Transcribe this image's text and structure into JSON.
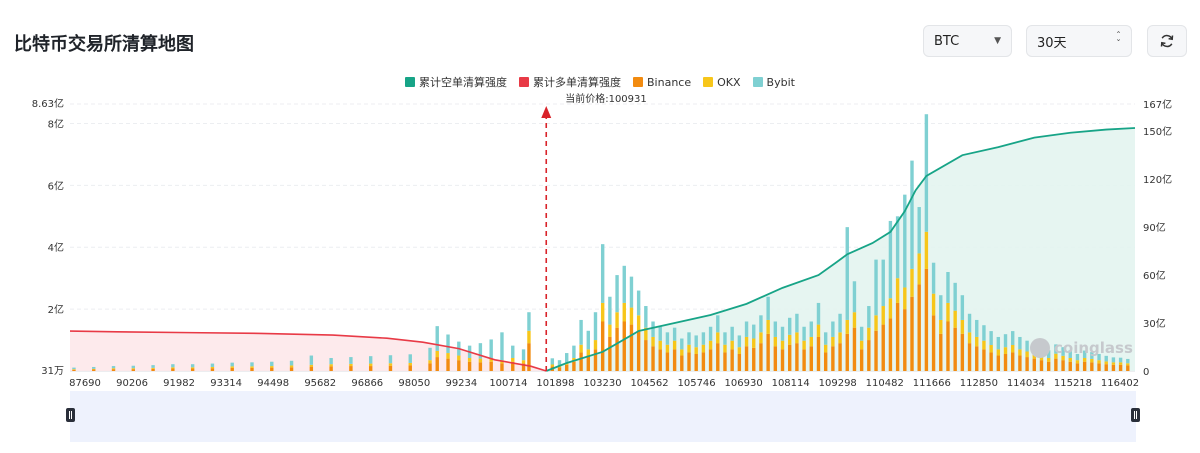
{
  "header": {
    "title": "比特币交易所清算地图"
  },
  "controls": {
    "coin_select": "BTC",
    "range_select": "30天"
  },
  "colors": {
    "short_cum": "#17a487",
    "long_cum": "#e83a46",
    "binance": "#f28b10",
    "okx": "#f7c61a",
    "bybit": "#7fd0d2",
    "price_line": "#d9232a"
  },
  "chart_data": {
    "type": "bar",
    "legend": [
      {
        "name": "累计空单清算强度",
        "color": "#17a487"
      },
      {
        "name": "累计多单清算强度",
        "color": "#e83a46"
      },
      {
        "name": "Binance",
        "color": "#f28b10"
      },
      {
        "name": "OKX",
        "color": "#f7c61a"
      },
      {
        "name": "Bybit",
        "color": "#7fd0d2"
      }
    ],
    "current_price_label": "当前价格:100931",
    "current_price": 100931,
    "x_range": [
      87690,
      117300
    ],
    "x_ticks": [
      "87690",
      "90206",
      "91982",
      "93314",
      "94498",
      "95682",
      "96866",
      "98050",
      "99234",
      "100714",
      "101898",
      "103230",
      "104562",
      "105746",
      "106930",
      "108114",
      "109298",
      "110482",
      "111666",
      "112850",
      "114034",
      "115218",
      "116402"
    ],
    "y_left": {
      "min_label": "31万",
      "max_label": "8.63亿",
      "ticks": [
        {
          "value": 2,
          "label": "2亿"
        },
        {
          "value": 4,
          "label": "4亿"
        },
        {
          "value": 6,
          "label": "6亿"
        },
        {
          "value": 8,
          "label": "8亿"
        }
      ],
      "range": [
        0.0031,
        8.63
      ],
      "unit": "亿"
    },
    "y_right": {
      "ticks": [
        {
          "value": 0,
          "label": "0"
        },
        {
          "value": 30,
          "label": "30亿"
        },
        {
          "value": 60,
          "label": "60亿"
        },
        {
          "value": 90,
          "label": "90亿"
        },
        {
          "value": 120,
          "label": "120亿"
        },
        {
          "value": 150,
          "label": "150亿"
        },
        {
          "value": 167,
          "label": "167亿"
        }
      ],
      "range": [
        0,
        167
      ],
      "unit": "亿"
    },
    "bars": {
      "x": [
        87800,
        88350,
        88900,
        89450,
        90000,
        90550,
        91100,
        91650,
        92200,
        92750,
        93300,
        93850,
        94400,
        94950,
        95500,
        96050,
        96600,
        97150,
        97700,
        97900,
        98200,
        98500,
        98800,
        99100,
        99400,
        99700,
        100000,
        100300,
        100450,
        101100,
        101300,
        101500,
        101700,
        101900,
        102100,
        102300,
        102500,
        102700,
        102900,
        103100,
        103300,
        103500,
        103700,
        103900,
        104100,
        104300,
        104500,
        104700,
        104900,
        105100,
        105300,
        105500,
        105700,
        105900,
        106100,
        106300,
        106500,
        106700,
        106900,
        107100,
        107300,
        107500,
        107700,
        107900,
        108100,
        108300,
        108500,
        108700,
        108900,
        109100,
        109300,
        109500,
        109700,
        109900,
        110100,
        110300,
        110500,
        110700,
        110900,
        111100,
        111300,
        111500,
        111700,
        111900,
        112100,
        112300,
        112500,
        112700,
        112900,
        113100,
        113300,
        113500,
        113700,
        113900,
        114100,
        114300,
        114500,
        114700,
        114900,
        115100,
        115300,
        115500,
        115700,
        115900,
        116100,
        116300,
        116500,
        116700,
        116900,
        117100
      ],
      "binance": [
        0.04,
        0.05,
        0.06,
        0.06,
        0.07,
        0.08,
        0.08,
        0.09,
        0.1,
        0.1,
        0.11,
        0.12,
        0.14,
        0.15,
        0.16,
        0.16,
        0.17,
        0.18,
        0.25,
        0.45,
        0.4,
        0.35,
        0.3,
        0.28,
        0.3,
        0.25,
        0.3,
        0.25,
        0.9,
        0.15,
        0.12,
        0.2,
        0.3,
        0.6,
        0.5,
        0.7,
        1.6,
        1.1,
        1.4,
        1.6,
        1.5,
        1.3,
        1.0,
        0.8,
        0.7,
        0.6,
        0.7,
        0.5,
        0.6,
        0.55,
        0.6,
        0.7,
        0.9,
        0.6,
        0.7,
        0.55,
        0.8,
        0.75,
        0.9,
        1.2,
        0.8,
        0.7,
        0.85,
        0.9,
        0.7,
        0.8,
        1.1,
        0.6,
        0.8,
        0.9,
        1.2,
        1.4,
        0.7,
        1.0,
        1.3,
        1.5,
        1.7,
        2.2,
        2.0,
        2.4,
        2.8,
        3.3,
        1.8,
        1.2,
        1.6,
        1.4,
        1.2,
        0.9,
        0.8,
        0.7,
        0.6,
        0.5,
        0.55,
        0.6,
        0.5,
        0.45,
        0.4,
        0.35,
        0.3,
        0.4,
        0.35,
        0.3,
        0.25,
        0.3,
        0.28,
        0.25,
        0.22,
        0.2,
        0.2,
        0.18
      ],
      "okx": [
        0.02,
        0.02,
        0.03,
        0.03,
        0.03,
        0.04,
        0.04,
        0.04,
        0.05,
        0.05,
        0.05,
        0.06,
        0.06,
        0.07,
        0.07,
        0.08,
        0.08,
        0.08,
        0.1,
        0.2,
        0.18,
        0.15,
        0.12,
        0.12,
        0.12,
        0.1,
        0.12,
        0.1,
        0.4,
        0.06,
        0.05,
        0.08,
        0.12,
        0.25,
        0.2,
        0.3,
        0.6,
        0.4,
        0.5,
        0.6,
        0.55,
        0.5,
        0.4,
        0.3,
        0.28,
        0.25,
        0.28,
        0.2,
        0.25,
        0.22,
        0.25,
        0.28,
        0.35,
        0.25,
        0.28,
        0.22,
        0.3,
        0.3,
        0.35,
        0.45,
        0.3,
        0.28,
        0.32,
        0.35,
        0.28,
        0.3,
        0.4,
        0.25,
        0.3,
        0.35,
        0.45,
        0.5,
        0.28,
        0.4,
        0.5,
        0.6,
        0.65,
        0.8,
        0.7,
        0.9,
        1.0,
        1.2,
        0.7,
        0.45,
        0.6,
        0.55,
        0.45,
        0.35,
        0.3,
        0.28,
        0.24,
        0.2,
        0.22,
        0.24,
        0.2,
        0.18,
        0.16,
        0.14,
        0.12,
        0.16,
        0.14,
        0.12,
        0.1,
        0.12,
        0.11,
        0.1,
        0.09,
        0.08,
        0.08,
        0.07
      ],
      "bybit": [
        0.05,
        0.06,
        0.07,
        0.08,
        0.09,
        0.1,
        0.1,
        0.11,
        0.12,
        0.13,
        0.14,
        0.15,
        0.3,
        0.2,
        0.22,
        0.24,
        0.26,
        0.28,
        0.4,
        0.8,
        0.6,
        0.45,
        0.4,
        0.5,
        0.6,
        0.9,
        0.4,
        0.35,
        0.6,
        0.2,
        0.18,
        0.3,
        0.4,
        0.8,
        0.6,
        0.9,
        1.9,
        0.9,
        1.2,
        1.2,
        1.0,
        0.8,
        0.7,
        0.5,
        0.45,
        0.4,
        0.42,
        0.35,
        0.4,
        0.38,
        0.4,
        0.45,
        0.55,
        0.4,
        0.45,
        0.38,
        0.5,
        0.45,
        0.55,
        0.75,
        0.5,
        0.45,
        0.55,
        0.6,
        0.45,
        0.5,
        0.7,
        0.4,
        0.5,
        0.6,
        3.0,
        1.0,
        0.45,
        0.7,
        1.8,
        1.5,
        2.5,
        2.0,
        3.0,
        3.5,
        1.5,
        3.8,
        1.0,
        0.8,
        1.0,
        0.9,
        0.8,
        0.6,
        0.55,
        0.5,
        0.45,
        0.4,
        0.42,
        0.45,
        0.4,
        0.35,
        0.3,
        0.28,
        0.25,
        0.3,
        0.28,
        0.25,
        0.2,
        0.24,
        0.22,
        0.2,
        0.18,
        0.16,
        0.15,
        0.14
      ]
    },
    "cumulative_long": {
      "x": [
        87690,
        89000,
        91000,
        93000,
        95000,
        96500,
        97500,
        98500,
        99500,
        100500,
        100931
      ],
      "y": [
        25,
        24.5,
        24,
        23.5,
        22.5,
        20.5,
        18,
        14,
        7,
        3,
        0
      ]
    },
    "cumulative_short": {
      "x": [
        100931,
        101500,
        102500,
        103500,
        104500,
        105500,
        106500,
        107500,
        108500,
        109000,
        109300,
        110000,
        110500,
        110900,
        111200,
        111500,
        112500,
        113500,
        114500,
        115500,
        116500,
        117300
      ],
      "y": [
        0,
        5,
        12,
        25,
        30,
        35,
        42,
        52,
        60,
        68,
        73,
        80,
        87,
        100,
        113,
        122,
        135,
        140,
        146,
        149,
        151,
        152
      ]
    }
  },
  "brand": {
    "watermark": "coinglass"
  }
}
